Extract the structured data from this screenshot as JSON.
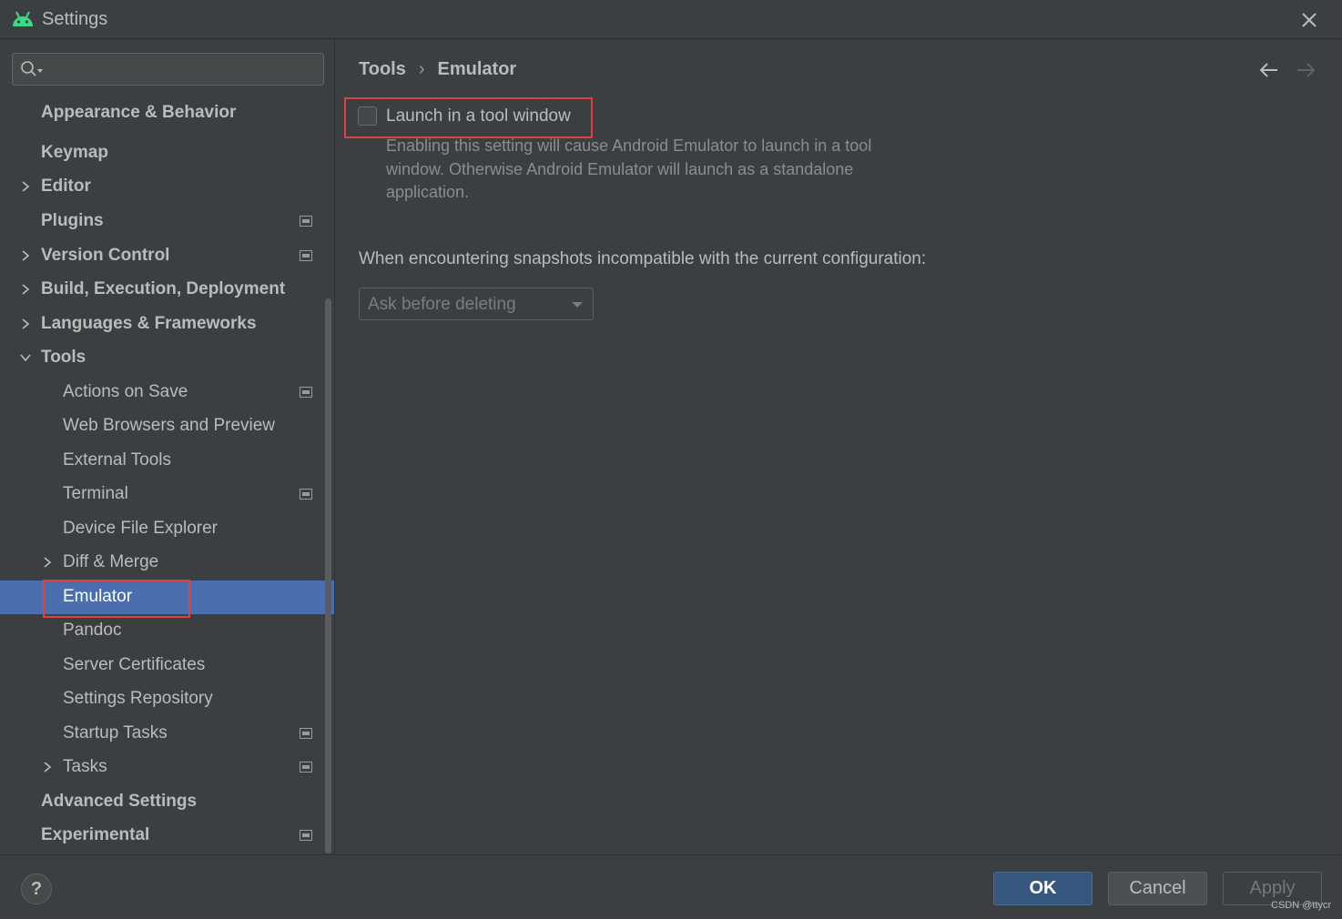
{
  "window": {
    "title": "Settings",
    "close_icon": "close-icon",
    "app_icon": "android-icon"
  },
  "sidebar": {
    "search": {
      "placeholder": "",
      "value": "",
      "icon": "search-icon"
    },
    "items": [
      {
        "label": "Appearance & Behavior",
        "bold": true
      },
      {
        "label": "Keymap",
        "bold": true
      },
      {
        "label": "Editor",
        "bold": true,
        "expand": "collapsed"
      },
      {
        "label": "Plugins",
        "bold": true,
        "project_icon": true
      },
      {
        "label": "Version Control",
        "bold": true,
        "expand": "collapsed",
        "project_icon": true
      },
      {
        "label": "Build, Execution, Deployment",
        "bold": true,
        "expand": "collapsed"
      },
      {
        "label": "Languages & Frameworks",
        "bold": true,
        "expand": "collapsed"
      },
      {
        "label": "Tools",
        "bold": true,
        "expand": "expanded"
      },
      {
        "label": "Actions on Save",
        "project_icon": true
      },
      {
        "label": "Web Browsers and Preview"
      },
      {
        "label": "External Tools"
      },
      {
        "label": "Terminal",
        "project_icon": true
      },
      {
        "label": "Device File Explorer"
      },
      {
        "label": "Diff & Merge",
        "expand": "collapsed"
      },
      {
        "label": "Emulator",
        "selected": true
      },
      {
        "label": "Pandoc"
      },
      {
        "label": "Server Certificates"
      },
      {
        "label": "Settings Repository"
      },
      {
        "label": "Startup Tasks",
        "project_icon": true
      },
      {
        "label": "Tasks",
        "expand": "collapsed",
        "project_icon": true
      },
      {
        "label": "Advanced Settings",
        "bold": true
      },
      {
        "label": "Experimental",
        "bold": true,
        "project_icon": true
      }
    ]
  },
  "content": {
    "breadcrumb": [
      "Tools",
      "Emulator"
    ],
    "breadcrumb_separator": "›",
    "back_icon": "arrow-left-icon",
    "forward_icon": "arrow-right-icon",
    "launch_checkbox": {
      "label": "Launch in a tool window",
      "checked": false,
      "description": "Enabling this setting will cause Android Emulator to launch in a tool window. Otherwise Android Emulator will launch as a standalone application."
    },
    "snapshot_question": "When encountering snapshots incompatible with the current configuration:",
    "snapshot_dropdown": {
      "value": "Ask before deleting"
    }
  },
  "footer": {
    "help_label": "?",
    "ok_label": "OK",
    "cancel_label": "Cancel",
    "apply_label": "Apply",
    "watermark": "CSDN @ttycr"
  },
  "colors": {
    "background": "#3c3f41",
    "selection": "#4b6eaf",
    "ok_button": "#365880",
    "highlight_box": "#e04040",
    "android_green": "#3ddc84"
  }
}
